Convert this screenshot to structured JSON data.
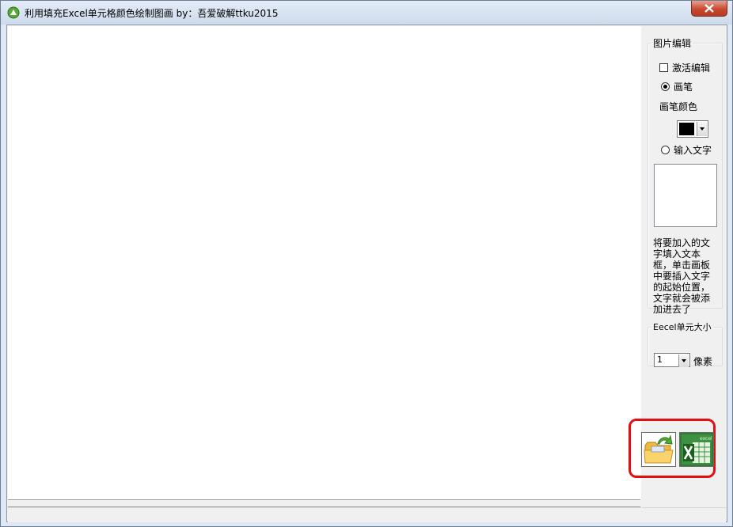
{
  "window": {
    "title": "利用填充Excel单元格颜色绘制图画 by：吾爱破解ttku2015"
  },
  "panel": {
    "edit_group": {
      "title": "图片编辑",
      "activate_edit": "激活编辑",
      "activate_checked": false,
      "pen_label": "画笔",
      "pen_selected": true,
      "pen_color_label": "画笔颜色",
      "pen_color": "#000000",
      "text_label": "输入文字",
      "text_selected": false,
      "text_value": "",
      "hint": "将要加入的文字填入文本框，单击画板中要插入文字的起始位置，文字就会被添加进去了"
    },
    "size_group": {
      "title": "Eecel单元大小",
      "value": "1",
      "unit": "像素"
    }
  },
  "toolbar": {
    "open_icon": "open-folder-icon",
    "excel_icon": "excel-export-icon",
    "excel_badge": "excel"
  },
  "colors": {
    "highlight": "#e01010",
    "close": "#c84a32"
  }
}
